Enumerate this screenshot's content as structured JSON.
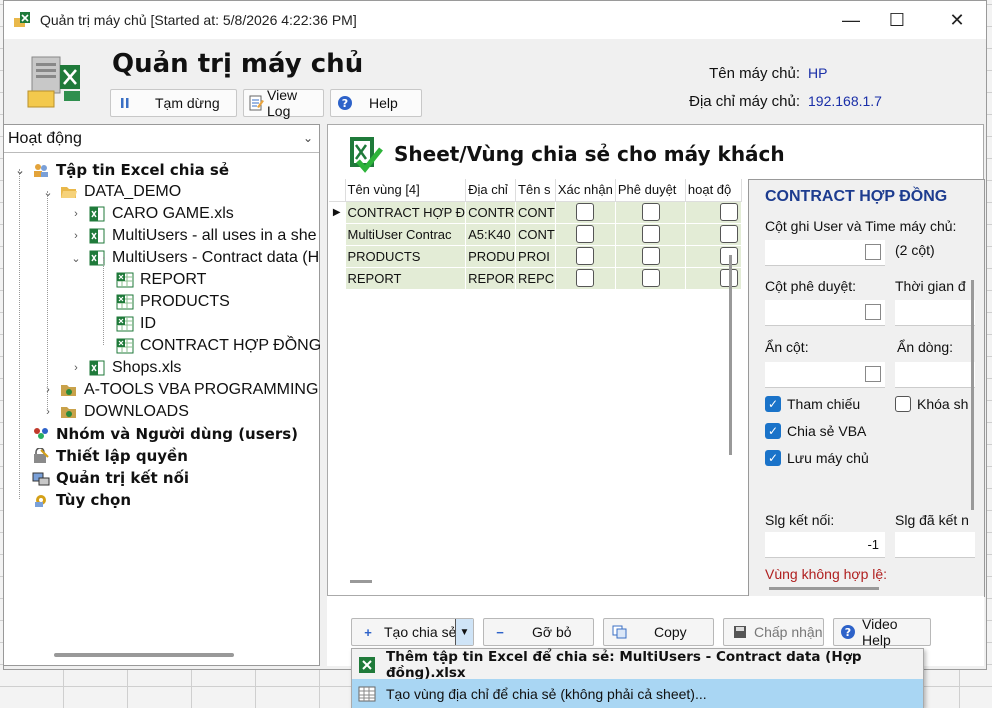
{
  "window": {
    "title": "Quản trị máy chủ [Started at: 5/8/2026 4:22:36 PM]",
    "minimize": "—",
    "maximize": "☐",
    "close": "✕"
  },
  "header": {
    "title": "Quản trị máy chủ",
    "buttons": {
      "pause": "Tạm dừng",
      "view_log": "View Log",
      "help": "Help"
    },
    "server_name_label": "Tên máy chủ:",
    "server_name": "HP",
    "server_address_label": "Địa chỉ máy chủ:",
    "server_address": "192.168.1.7"
  },
  "sidebar": {
    "dropdown": "Hoạt động",
    "tree": [
      {
        "label": "Tập tin Excel chia sẻ",
        "level": 1,
        "bold": true,
        "expander": "expanded",
        "icon": "users-icon"
      },
      {
        "label": "DATA_DEMO",
        "level": 2,
        "expander": "expanded",
        "icon": "folder-open-icon"
      },
      {
        "label": "CARO GAME.xls",
        "level": 3,
        "expander": "collapsed",
        "icon": "excel-icon"
      },
      {
        "label": "MultiUsers - all uses in a she",
        "level": 3,
        "expander": "collapsed",
        "icon": "excel-icon"
      },
      {
        "label": "MultiUsers - Contract data (H",
        "level": 3,
        "expander": "expanded",
        "icon": "excel-icon"
      },
      {
        "label": "REPORT",
        "level": 4,
        "icon": "sheet-icon"
      },
      {
        "label": "PRODUCTS",
        "level": 4,
        "icon": "sheet-icon"
      },
      {
        "label": "ID",
        "level": 4,
        "icon": "sheet-icon"
      },
      {
        "label": "CONTRACT HỢP ĐỒNG",
        "level": 4,
        "icon": "sheet-icon"
      },
      {
        "label": "Shops.xls",
        "level": 3,
        "expander": "collapsed",
        "icon": "excel-icon"
      },
      {
        "label": "A-TOOLS VBA PROGRAMMING",
        "level": 2,
        "expander": "collapsed",
        "icon": "folder-icon"
      },
      {
        "label": "DOWNLOADS",
        "level": 2,
        "expander": "collapsed",
        "icon": "folder-icon"
      },
      {
        "label": "Nhóm và Người dùng (users)",
        "level": 1,
        "bold": true,
        "icon": "group-icon"
      },
      {
        "label": "Thiết lập quyền",
        "level": 1,
        "bold": true,
        "icon": "permission-icon"
      },
      {
        "label": "Quản trị kết nối",
        "level": 1,
        "bold": true,
        "icon": "connection-icon"
      },
      {
        "label": "Tùy chọn",
        "level": 1,
        "bold": true,
        "icon": "options-icon"
      }
    ]
  },
  "sheets": {
    "title": "Sheet/Vùng chia sẻ cho máy khách",
    "columns": [
      "Tên vùng [4]",
      "Địa chỉ",
      "Tên s",
      "Xác nhận",
      "Phê duyệt",
      "hoạt độ"
    ],
    "rows": [
      {
        "name": "CONTRACT HỢP Đ",
        "address": "CONTR",
        "sheet": "CONT",
        "current": true
      },
      {
        "name": "MultiUser Contrac",
        "address": "A5:K40",
        "sheet": "CONT",
        "current": false
      },
      {
        "name": "PRODUCTS",
        "address": "PRODU",
        "sheet": "PROI",
        "current": false
      },
      {
        "name": "REPORT",
        "address": "REPOR",
        "sheet": "REPC",
        "current": false
      }
    ]
  },
  "detail": {
    "title": "CONTRACT HỢP ĐỒNG",
    "user_time_col_label": "Cột ghi User và Time máy chủ:",
    "two_cols": "(2 cột)",
    "approve_col_label": "Cột phê duyệt:",
    "approve_time_label": "Thời gian đ",
    "hide_col_label": "Ẩn cột:",
    "hide_row_label": "Ẩn dòng:",
    "chk_reference": "Tham chiếu",
    "chk_share_vba": "Chia sẻ VBA",
    "chk_save_server": "Lưu máy chủ",
    "chk_lock": "Khóa sh",
    "conn_count_label": "Slg kết nối:",
    "conn_count_value": "-1",
    "conn_done_label": "Slg đã kết n",
    "invalid_range_label": "Vùng không hợp lệ:"
  },
  "actions": {
    "create_share": "Tạo chia sẻ",
    "remove": "Gỡ bỏ",
    "copy": "Copy",
    "accept": "Chấp nhận",
    "video_help": "Video Help"
  },
  "menu": {
    "item1": "Thêm tập tin Excel để chia sẻ: MultiUsers - Contract data (Hợp đồng).xlsx",
    "item2": "Tạo vùng địa chỉ để chia sẻ (không phải cả sheet)..."
  },
  "colors": {
    "accent_blue": "#1a73c9",
    "detail_title": "#1d3c8f",
    "row_green": "#e3ecd6",
    "menu_selected": "#a9d6f3",
    "excel_green": "#1f7a3a"
  }
}
